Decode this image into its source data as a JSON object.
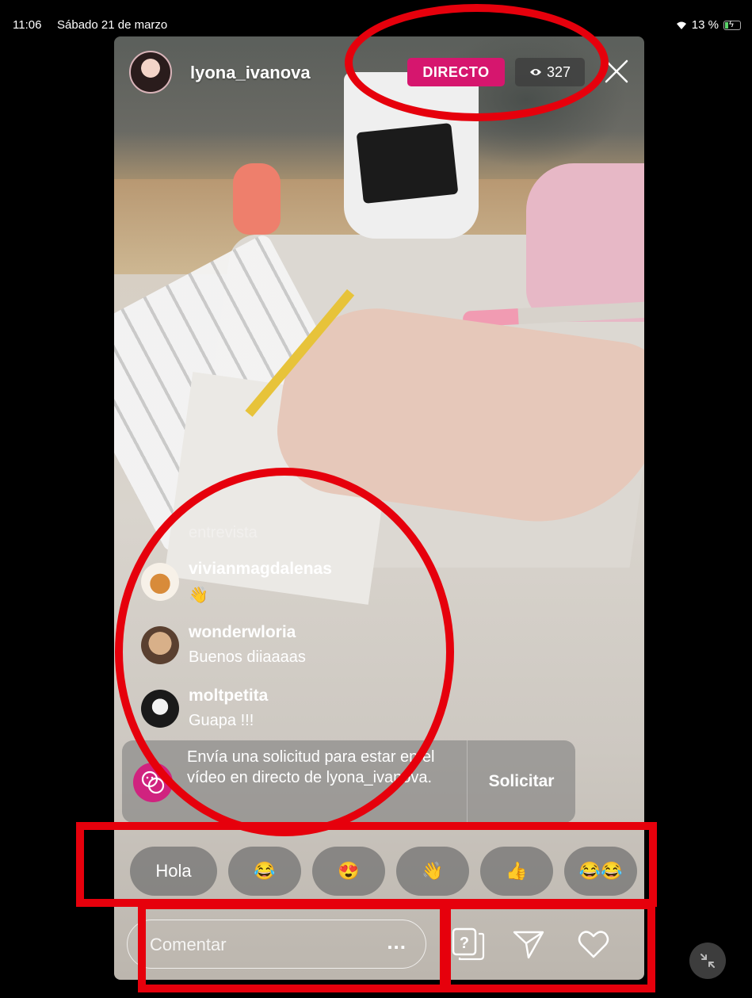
{
  "status_bar": {
    "time": "11:06",
    "date": "Sábado 21 de marzo",
    "battery": "13 %"
  },
  "live": {
    "host_username": "lyona_ivanova",
    "live_label": "DIRECTO",
    "viewer_count": "327"
  },
  "comments": {
    "faded_text": "entrevista",
    "items": [
      {
        "user": "vivianmagdalenas",
        "text": "👋"
      },
      {
        "user": "wonderwloria",
        "text": "Buenos  diiaaaas"
      },
      {
        "user": "moltpetita",
        "text": "Guapa !!!"
      }
    ]
  },
  "request": {
    "text": "Envía una solicitud para estar en el vídeo en directo de lyona_ivanova.",
    "button": "Solicitar"
  },
  "quick_replies": [
    "Hola",
    "😂",
    "😍",
    "👋",
    "👍",
    "😂😂"
  ],
  "composer": {
    "placeholder": "Comentar",
    "more": "..."
  },
  "colors": {
    "live_badge": "#d6166e",
    "annotation": "#e6000c",
    "request_icon": "#d0237f"
  }
}
